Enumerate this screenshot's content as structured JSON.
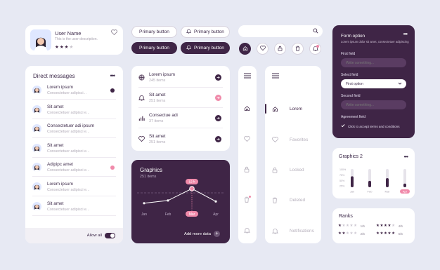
{
  "profile": {
    "name": "User Name",
    "description": "This is the user description.",
    "rating": 3,
    "rating_max": 5
  },
  "buttons": {
    "primary_1": "Primary button",
    "primary_2": "Primary button",
    "primary_3": "Primary button",
    "primary_4": "Primary button"
  },
  "search": {
    "placeholder": ""
  },
  "icon_buttons": [
    "home-icon",
    "heart-icon",
    "lock-icon",
    "trash-icon",
    "bell-icon"
  ],
  "direct_messages": {
    "title": "Direct messages",
    "items": [
      {
        "name": "Lorem ipsum",
        "text": "Consectetuer adipisci...",
        "badge": "dark"
      },
      {
        "name": "Sit amet",
        "text": "Consectetuer adipisci e...",
        "badge": ""
      },
      {
        "name": "Consectetuer adi ipsum",
        "text": "Consectetuer adipisci e...",
        "badge": ""
      },
      {
        "name": "Sit amet",
        "text": "Consectetuer adipisci e...",
        "badge": ""
      },
      {
        "name": "Adipipc amet",
        "text": "Consectetuer adipisci e...",
        "badge": "pink"
      },
      {
        "name": "Lorem ipsum",
        "text": "Consectetuer adipisci e...",
        "badge": ""
      },
      {
        "name": "Sit amet",
        "text": "Consectetuer adipisci e...",
        "badge": ""
      }
    ],
    "allow_all": "Allow all",
    "allow_all_on": true
  },
  "list": {
    "items": [
      {
        "title": "Lorem ipsum",
        "sub": "245 items",
        "icon": "basketball-icon",
        "arrow": "dark"
      },
      {
        "title": "Sit amet",
        "sub": "251 items",
        "icon": "bell-icon",
        "arrow": "pink"
      },
      {
        "title": "Consectue adi",
        "sub": "37 items",
        "icon": "bar-chart-icon",
        "arrow": "dark"
      },
      {
        "title": "Sit amet",
        "sub": "251 items",
        "icon": "heart-icon",
        "arrow": "dark"
      }
    ]
  },
  "graphics_dark": {
    "title": "Graphics",
    "subtitle": "251 items",
    "tooltip": "12 h",
    "selected_month": "Mar",
    "add_more": "Add more data"
  },
  "nav": {
    "items": [
      {
        "label": "Lorem",
        "icon": "home-icon",
        "active": true
      },
      {
        "label": "Favorites",
        "icon": "heart-icon",
        "active": false
      },
      {
        "label": "Locked",
        "icon": "lock-icon",
        "active": false
      },
      {
        "label": "Deleted",
        "icon": "trash-icon",
        "active": false
      },
      {
        "label": "Notifications",
        "icon": "bell-icon",
        "active": false
      }
    ]
  },
  "form": {
    "title": "Form option",
    "subtitle": "Lorem ipsum dolor sit amet, consectetuer adipiscing",
    "first_field_label": "First field",
    "first_field_placeholder": "Write something...",
    "select_label": "Select field",
    "select_value": "First option",
    "second_field_label": "Second field",
    "second_field_placeholder": "Write something...",
    "agreement_label": "Agreement field",
    "agreement_text": "Click to accept terms and conditions",
    "agreement_checked": true
  },
  "graphics_small": {
    "title": "Graphics",
    "count": "2",
    "y_ticks": [
      "100%",
      "75%",
      "50%",
      "25%"
    ],
    "bars": [
      {
        "label": "Jan",
        "fill": 0.6
      },
      {
        "label": "Feb",
        "fill": 0.35
      },
      {
        "label": "Mar",
        "fill": 0.5
      },
      {
        "label": "Apr",
        "fill": 0.2
      }
    ],
    "highlight": "Apr"
  },
  "ranks": {
    "title": "Ranks",
    "rows": [
      {
        "stars": 1,
        "value": "1/5"
      },
      {
        "stars": 4,
        "value": "4/5"
      },
      {
        "stars": 2,
        "value": "2/5"
      },
      {
        "stars": 5,
        "value": "5/5"
      }
    ]
  },
  "colors": {
    "accent": "#3f2546",
    "pink": "#f08aaa",
    "bg": "#e7e9f3"
  },
  "chart_data": {
    "type": "line",
    "title": "Graphics",
    "categories": [
      "Jan",
      "Feb",
      "Mar",
      "Apr"
    ],
    "values": [
      0.2,
      0.35,
      1.0,
      0.3
    ],
    "ylim": [
      0,
      1
    ]
  }
}
